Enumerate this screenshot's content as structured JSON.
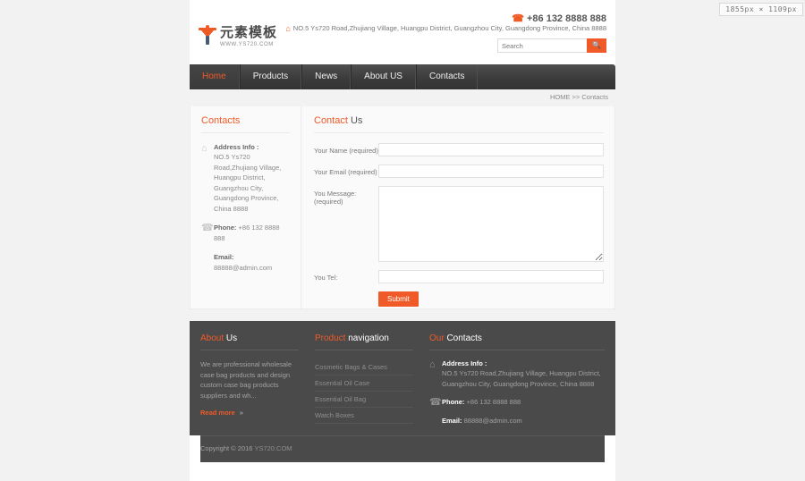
{
  "size_badge": "1855px × 1109px",
  "header": {
    "logo_cn": "元素模板",
    "logo_url": "WWW.YS720.COM",
    "phone_icon": "phone-icon",
    "phone": "+86 132 8888 888",
    "home_icon": "home-icon",
    "address": "NO.5 Ys720 Road,Zhujiang Village, Huangpu District, Guangzhou City, Guangdong Province, China 8888",
    "search_placeholder": "Search",
    "search_value": "",
    "search_icon": "search-icon"
  },
  "nav": {
    "items": [
      {
        "label": "Home",
        "active": true
      },
      {
        "label": "Products",
        "active": false
      },
      {
        "label": "News",
        "active": false
      },
      {
        "label": "About US",
        "active": false
      },
      {
        "label": "Contacts",
        "active": false
      }
    ]
  },
  "breadcrumb": "HOME >> Contacts",
  "sidebar": {
    "title": "Contacts",
    "address_icon": "home-icon",
    "address_label": "Address Info :",
    "address_text": "NO.5 Ys720 Road,Zhujiang Village, Huangpu District, Guangzhou City, Guangdong Province, China 8888",
    "phone_icon": "phone-icon",
    "phone_label": "Phone:",
    "phone_value": "+86 132 8888 888",
    "email_label": "Email:",
    "email_value": "88888@admin.com"
  },
  "form": {
    "title_word1": "Contact",
    "title_word2": "Us",
    "name_label": "Your Name (required)",
    "name_value": "",
    "email_label": "Your Email (required)",
    "email_value": "",
    "message_label": "You Message: (required)",
    "message_value": "",
    "tel_label": "You Tel:",
    "tel_value": "",
    "submit_label": "Submit"
  },
  "footer": {
    "about": {
      "title_word1": "About",
      "title_word2": "Us",
      "text": "We are professional wholesale case bag products and design custom case bag products suppliers and wh...",
      "read_more": "Read more",
      "read_more_arrow": "»"
    },
    "product_nav": {
      "title_word1": "Product",
      "title_word2": "navigation",
      "items": [
        "Cosmetic Bags & Cases",
        "Essential Oil Case",
        "Essential Oil Bag",
        "Watch Boxes"
      ]
    },
    "contacts": {
      "title_word1": "Our",
      "title_word2": "Contacts",
      "address_icon": "home-icon",
      "address_label": "Address Info :",
      "address_text": "NO.5 Ys720 Road,Zhujiang Village, Huangpu District, Guangzhou City, Guangdong Province, China 8888",
      "phone_icon": "phone-icon",
      "phone_label": "Phone:",
      "phone_value": "+86 132 8888 888",
      "email_label": "Email:",
      "email_value": "88888@admin.com"
    },
    "copyright_prefix": "Copyright © 2016",
    "copyright_site": "YS720.COM"
  },
  "colors": {
    "accent": "#f05a28",
    "nav_dark": "#3d3d3d",
    "footer_dark": "#4a4a4a",
    "page_bg": "#f2f2f2"
  }
}
